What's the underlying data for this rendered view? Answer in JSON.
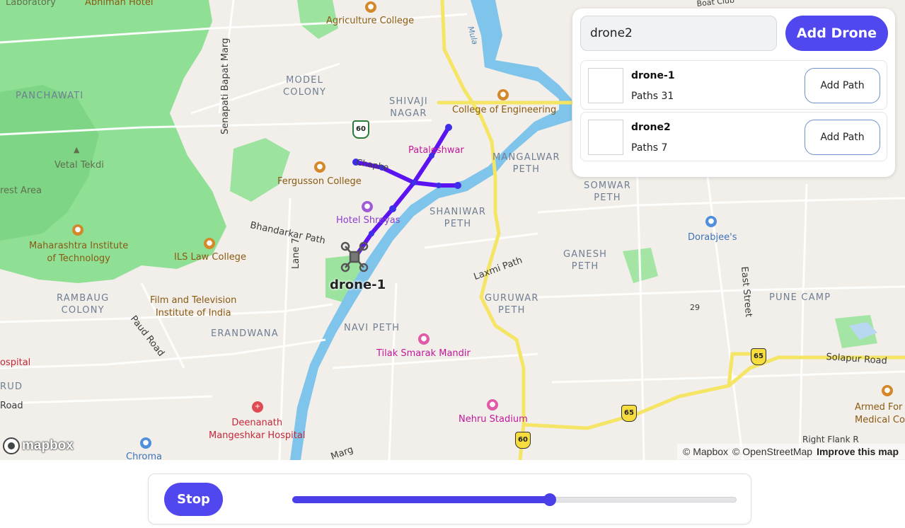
{
  "map": {
    "areas": [
      "MODEL\nCOLONY",
      "SHIVAJI\nNAGAR",
      "MANGALWAR\nPETH",
      "SOMWAR\nPETH",
      "PANCHAWATI",
      "SHANIWAR\nPETH",
      "GANESH\nPETH",
      "RAMBAUG\nCOLONY",
      "GURUWAR\nPETH",
      "PUNE CAMP",
      "ERANDWANA",
      "NAVI PETH",
      "RUD"
    ],
    "pois": {
      "laboratory": "Laboratory",
      "abhiman": "Abhiman Hotel",
      "agriculture": "Agriculture College",
      "engineering": "College of Engineering",
      "patalesh": "Pataleshwar",
      "fergusson": "Fergusson College",
      "shreyas": "Hotel Shreyas",
      "vetal": "Vetal Tekdi",
      "forest": "rest Area",
      "mit": "Maharashtra Institute\nof Technology",
      "ils": "ILS Law College",
      "ftii": "Film and Television\nInstitute of India",
      "tilak": "Tilak Smarak Mandir",
      "deenanath": "Deenanath\nMangeshkar Hospital",
      "nehru": "Nehru Stadium",
      "dorabjee": "Dorabjee's",
      "armed": "Armed For\nMedical Col",
      "hospital": "ospital",
      "chroma": "Chroma"
    },
    "streets": {
      "senapati": "Senapati Bapat Marg",
      "bhandarkar": "Bhandarkar Path",
      "lane7": "Lane 7",
      "laxmi": "Laxmi Path",
      "east": "East Street",
      "paud": "Paud Road",
      "solapur": "Solapur Road",
      "road": "Road",
      "marg": "Marg",
      "boat": "Boat Club",
      "mula": "Mula",
      "rightflank": "Right Flank R",
      "num29": "29",
      "chaphe": "Chaphe"
    },
    "shields": [
      "60",
      "65",
      "65",
      "60"
    ],
    "drone_label": "drone-1",
    "logo": "mapbox",
    "attribution": {
      "mapbox": "© Mapbox",
      "osm": "© OpenStreetMap",
      "improve": "Improve this map"
    },
    "colors": {
      "path": "#5b13f2",
      "park": "#8fe095",
      "water": "#7fc4ea",
      "highway": "#f4e565"
    }
  },
  "panel": {
    "drone_input": {
      "value": "drone2"
    },
    "add_drone_label": "Add Drone",
    "drones": [
      {
        "name": "drone-1",
        "paths": "Paths 31",
        "add_path_label": "Add Path"
      },
      {
        "name": "drone2",
        "paths": "Paths 7",
        "add_path_label": "Add Path"
      }
    ]
  },
  "controls": {
    "stop_label": "Stop",
    "progress": 0.58
  }
}
